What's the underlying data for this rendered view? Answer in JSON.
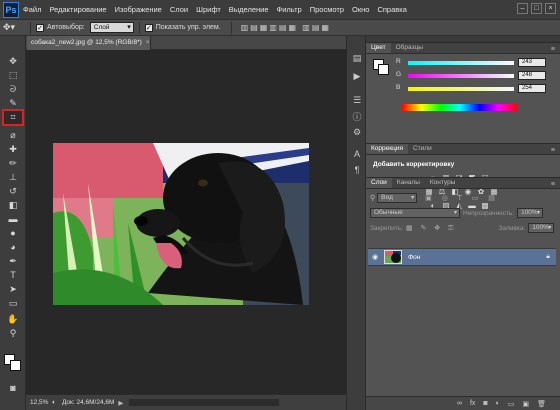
{
  "app": {
    "logo": "Ps"
  },
  "menu": [
    "Файл",
    "Редактирование",
    "Изображение",
    "Слои",
    "Шрифт",
    "Выделение",
    "Фильтр",
    "Просмотр",
    "Окно",
    "Справка"
  ],
  "options": {
    "auto_select_label": "Автовыбор:",
    "auto_select_value": "Слой",
    "show_controls_label": "Показать упр. элем."
  },
  "document": {
    "tab_title": "собака2_new2.jpg @ 12,5% (RGB/8*)",
    "zoom": "12,5%",
    "doc_info": "Док: 24,6M/24,6M"
  },
  "color_panel": {
    "tabs": [
      "Цвет",
      "Образцы"
    ],
    "sliders": [
      {
        "label": "R",
        "value": "243"
      },
      {
        "label": "G",
        "value": "248"
      },
      {
        "label": "B",
        "value": "254"
      }
    ]
  },
  "adjust_panel": {
    "tabs": [
      "Коррекция",
      "Стили"
    ],
    "title": "Добавить корректировку"
  },
  "layers_panel": {
    "tabs": [
      "Слои",
      "Каналы",
      "Контуры"
    ],
    "kind_filter": "Вид",
    "blend_mode": "Обычные",
    "opacity_label": "Непрозрачность:",
    "opacity_value": "100%",
    "lock_label": "Закрепить:",
    "fill_label": "Заливка:",
    "fill_value": "100%",
    "layer_name": "Фон"
  },
  "colors": {
    "accent_red": "#d8191c",
    "selected_layer": "#5a7295"
  }
}
